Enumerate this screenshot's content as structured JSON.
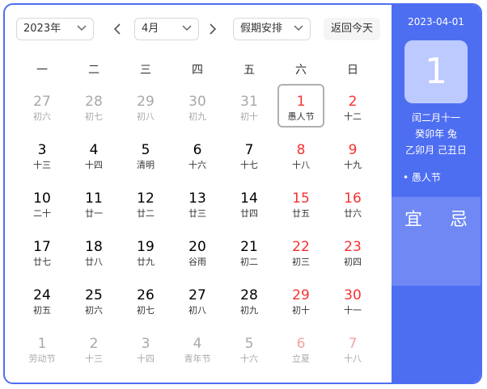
{
  "toolbar": {
    "year_select": "2023年",
    "month_select": "4月",
    "holiday_select": "假期安排",
    "today_button": "返回今天"
  },
  "weekdays": [
    "一",
    "二",
    "三",
    "四",
    "五",
    "六",
    "日"
  ],
  "days": [
    {
      "d": "27",
      "l": "初六",
      "other": true,
      "weekend": false
    },
    {
      "d": "28",
      "l": "初七",
      "other": true,
      "weekend": false
    },
    {
      "d": "29",
      "l": "初八",
      "other": true,
      "weekend": false
    },
    {
      "d": "30",
      "l": "初九",
      "other": true,
      "weekend": false
    },
    {
      "d": "31",
      "l": "初十",
      "other": true,
      "weekend": false
    },
    {
      "d": "1",
      "l": "愚人节",
      "other": false,
      "weekend": true,
      "selected": true
    },
    {
      "d": "2",
      "l": "十二",
      "other": false,
      "weekend": true
    },
    {
      "d": "3",
      "l": "十三",
      "other": false,
      "weekend": false
    },
    {
      "d": "4",
      "l": "十四",
      "other": false,
      "weekend": false
    },
    {
      "d": "5",
      "l": "清明",
      "other": false,
      "weekend": false
    },
    {
      "d": "6",
      "l": "十六",
      "other": false,
      "weekend": false
    },
    {
      "d": "7",
      "l": "十七",
      "other": false,
      "weekend": false
    },
    {
      "d": "8",
      "l": "十八",
      "other": false,
      "weekend": true
    },
    {
      "d": "9",
      "l": "十九",
      "other": false,
      "weekend": true
    },
    {
      "d": "10",
      "l": "二十",
      "other": false,
      "weekend": false
    },
    {
      "d": "11",
      "l": "廿一",
      "other": false,
      "weekend": false
    },
    {
      "d": "12",
      "l": "廿二",
      "other": false,
      "weekend": false
    },
    {
      "d": "13",
      "l": "廿三",
      "other": false,
      "weekend": false
    },
    {
      "d": "14",
      "l": "廿四",
      "other": false,
      "weekend": false
    },
    {
      "d": "15",
      "l": "廿五",
      "other": false,
      "weekend": true
    },
    {
      "d": "16",
      "l": "廿六",
      "other": false,
      "weekend": true
    },
    {
      "d": "17",
      "l": "廿七",
      "other": false,
      "weekend": false
    },
    {
      "d": "18",
      "l": "廿八",
      "other": false,
      "weekend": false
    },
    {
      "d": "19",
      "l": "廿九",
      "other": false,
      "weekend": false
    },
    {
      "d": "20",
      "l": "谷雨",
      "other": false,
      "weekend": false
    },
    {
      "d": "21",
      "l": "初二",
      "other": false,
      "weekend": false
    },
    {
      "d": "22",
      "l": "初三",
      "other": false,
      "weekend": true
    },
    {
      "d": "23",
      "l": "初四",
      "other": false,
      "weekend": true
    },
    {
      "d": "24",
      "l": "初五",
      "other": false,
      "weekend": false
    },
    {
      "d": "25",
      "l": "初六",
      "other": false,
      "weekend": false
    },
    {
      "d": "26",
      "l": "初七",
      "other": false,
      "weekend": false
    },
    {
      "d": "27",
      "l": "初八",
      "other": false,
      "weekend": false
    },
    {
      "d": "28",
      "l": "初九",
      "other": false,
      "weekend": false
    },
    {
      "d": "29",
      "l": "初十",
      "other": false,
      "weekend": true
    },
    {
      "d": "30",
      "l": "十一",
      "other": false,
      "weekend": true
    },
    {
      "d": "1",
      "l": "劳动节",
      "other": true,
      "weekend": false
    },
    {
      "d": "2",
      "l": "十三",
      "other": true,
      "weekend": false
    },
    {
      "d": "3",
      "l": "十四",
      "other": true,
      "weekend": false
    },
    {
      "d": "4",
      "l": "青年节",
      "other": true,
      "weekend": false
    },
    {
      "d": "5",
      "l": "十六",
      "other": true,
      "weekend": false
    },
    {
      "d": "6",
      "l": "立夏",
      "other": true,
      "weekend": true
    },
    {
      "d": "7",
      "l": "十八",
      "other": true,
      "weekend": true
    }
  ],
  "detail": {
    "date": "2023-04-01",
    "day": "1",
    "lunar": "闰二月十一",
    "year_ganzhi": "癸卯年 兔",
    "month_day_ganzhi": "乙卯月 己丑日",
    "festival": "• 愚人节",
    "yi": "宜",
    "ji": "忌"
  },
  "colors": {
    "accent": "#4e6ef2",
    "weekend": "#f73131"
  }
}
